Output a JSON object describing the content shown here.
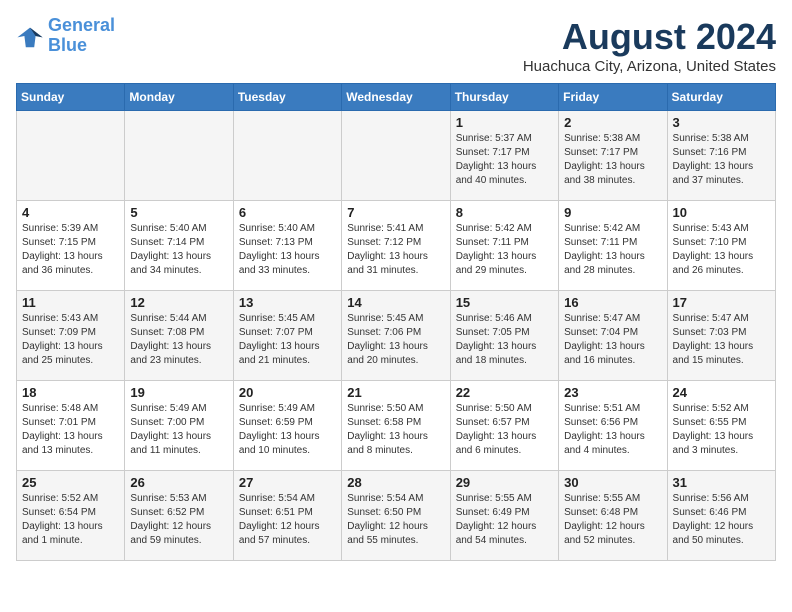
{
  "logo": {
    "line1": "General",
    "line2": "Blue"
  },
  "title": "August 2024",
  "location": "Huachuca City, Arizona, United States",
  "days_of_week": [
    "Sunday",
    "Monday",
    "Tuesday",
    "Wednesday",
    "Thursday",
    "Friday",
    "Saturday"
  ],
  "weeks": [
    [
      {
        "day": "",
        "info": ""
      },
      {
        "day": "",
        "info": ""
      },
      {
        "day": "",
        "info": ""
      },
      {
        "day": "",
        "info": ""
      },
      {
        "day": "1",
        "info": "Sunrise: 5:37 AM\nSunset: 7:17 PM\nDaylight: 13 hours\nand 40 minutes."
      },
      {
        "day": "2",
        "info": "Sunrise: 5:38 AM\nSunset: 7:17 PM\nDaylight: 13 hours\nand 38 minutes."
      },
      {
        "day": "3",
        "info": "Sunrise: 5:38 AM\nSunset: 7:16 PM\nDaylight: 13 hours\nand 37 minutes."
      }
    ],
    [
      {
        "day": "4",
        "info": "Sunrise: 5:39 AM\nSunset: 7:15 PM\nDaylight: 13 hours\nand 36 minutes."
      },
      {
        "day": "5",
        "info": "Sunrise: 5:40 AM\nSunset: 7:14 PM\nDaylight: 13 hours\nand 34 minutes."
      },
      {
        "day": "6",
        "info": "Sunrise: 5:40 AM\nSunset: 7:13 PM\nDaylight: 13 hours\nand 33 minutes."
      },
      {
        "day": "7",
        "info": "Sunrise: 5:41 AM\nSunset: 7:12 PM\nDaylight: 13 hours\nand 31 minutes."
      },
      {
        "day": "8",
        "info": "Sunrise: 5:42 AM\nSunset: 7:11 PM\nDaylight: 13 hours\nand 29 minutes."
      },
      {
        "day": "9",
        "info": "Sunrise: 5:42 AM\nSunset: 7:11 PM\nDaylight: 13 hours\nand 28 minutes."
      },
      {
        "day": "10",
        "info": "Sunrise: 5:43 AM\nSunset: 7:10 PM\nDaylight: 13 hours\nand 26 minutes."
      }
    ],
    [
      {
        "day": "11",
        "info": "Sunrise: 5:43 AM\nSunset: 7:09 PM\nDaylight: 13 hours\nand 25 minutes."
      },
      {
        "day": "12",
        "info": "Sunrise: 5:44 AM\nSunset: 7:08 PM\nDaylight: 13 hours\nand 23 minutes."
      },
      {
        "day": "13",
        "info": "Sunrise: 5:45 AM\nSunset: 7:07 PM\nDaylight: 13 hours\nand 21 minutes."
      },
      {
        "day": "14",
        "info": "Sunrise: 5:45 AM\nSunset: 7:06 PM\nDaylight: 13 hours\nand 20 minutes."
      },
      {
        "day": "15",
        "info": "Sunrise: 5:46 AM\nSunset: 7:05 PM\nDaylight: 13 hours\nand 18 minutes."
      },
      {
        "day": "16",
        "info": "Sunrise: 5:47 AM\nSunset: 7:04 PM\nDaylight: 13 hours\nand 16 minutes."
      },
      {
        "day": "17",
        "info": "Sunrise: 5:47 AM\nSunset: 7:03 PM\nDaylight: 13 hours\nand 15 minutes."
      }
    ],
    [
      {
        "day": "18",
        "info": "Sunrise: 5:48 AM\nSunset: 7:01 PM\nDaylight: 13 hours\nand 13 minutes."
      },
      {
        "day": "19",
        "info": "Sunrise: 5:49 AM\nSunset: 7:00 PM\nDaylight: 13 hours\nand 11 minutes."
      },
      {
        "day": "20",
        "info": "Sunrise: 5:49 AM\nSunset: 6:59 PM\nDaylight: 13 hours\nand 10 minutes."
      },
      {
        "day": "21",
        "info": "Sunrise: 5:50 AM\nSunset: 6:58 PM\nDaylight: 13 hours\nand 8 minutes."
      },
      {
        "day": "22",
        "info": "Sunrise: 5:50 AM\nSunset: 6:57 PM\nDaylight: 13 hours\nand 6 minutes."
      },
      {
        "day": "23",
        "info": "Sunrise: 5:51 AM\nSunset: 6:56 PM\nDaylight: 13 hours\nand 4 minutes."
      },
      {
        "day": "24",
        "info": "Sunrise: 5:52 AM\nSunset: 6:55 PM\nDaylight: 13 hours\nand 3 minutes."
      }
    ],
    [
      {
        "day": "25",
        "info": "Sunrise: 5:52 AM\nSunset: 6:54 PM\nDaylight: 13 hours\nand 1 minute."
      },
      {
        "day": "26",
        "info": "Sunrise: 5:53 AM\nSunset: 6:52 PM\nDaylight: 12 hours\nand 59 minutes."
      },
      {
        "day": "27",
        "info": "Sunrise: 5:54 AM\nSunset: 6:51 PM\nDaylight: 12 hours\nand 57 minutes."
      },
      {
        "day": "28",
        "info": "Sunrise: 5:54 AM\nSunset: 6:50 PM\nDaylight: 12 hours\nand 55 minutes."
      },
      {
        "day": "29",
        "info": "Sunrise: 5:55 AM\nSunset: 6:49 PM\nDaylight: 12 hours\nand 54 minutes."
      },
      {
        "day": "30",
        "info": "Sunrise: 5:55 AM\nSunset: 6:48 PM\nDaylight: 12 hours\nand 52 minutes."
      },
      {
        "day": "31",
        "info": "Sunrise: 5:56 AM\nSunset: 6:46 PM\nDaylight: 12 hours\nand 50 minutes."
      }
    ]
  ]
}
